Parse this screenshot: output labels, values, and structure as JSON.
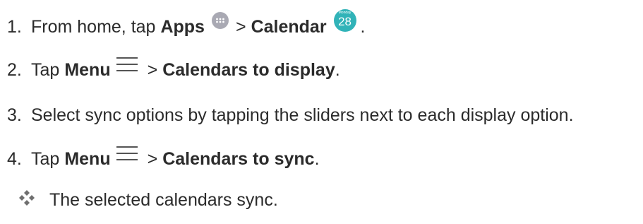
{
  "steps": [
    {
      "number": "1.",
      "text_before": "From home, tap",
      "bold_a": "Apps",
      "separator": ">",
      "bold_b": "Calendar",
      "end": ".",
      "apps_icon": "apps-grid-icon",
      "calendar_icon": {
        "name": "calendar-app-icon",
        "top_label": "Monday",
        "day": "28",
        "color": "#31b3b8"
      }
    },
    {
      "number": "2.",
      "text_before": "Tap",
      "bold_a": "Menu",
      "separator": ">",
      "bold_b": "Calendars to display",
      "end": ".",
      "menu_icon": "hamburger-menu-icon"
    },
    {
      "number": "3.",
      "text": "Select sync options by tapping the sliders next to each display option."
    },
    {
      "number": "4.",
      "text_before": "Tap",
      "bold_a": "Menu",
      "separator": ">",
      "bold_b": "Calendars to sync",
      "end": ".",
      "menu_icon": "hamburger-menu-icon"
    }
  ],
  "result": {
    "icon": "four-diamond-bullet-icon",
    "text": "The selected calendars sync."
  },
  "colors": {
    "text": "#2b2b2b",
    "apps_icon_bg": "#a9a9b3",
    "calendar_icon_bg": "#31b3b8",
    "bullet_color": "#7a7a7a"
  }
}
